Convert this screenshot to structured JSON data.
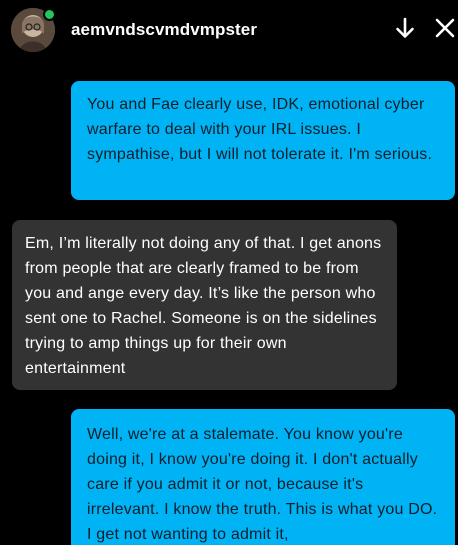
{
  "header": {
    "username": "aemvndscvmdvmpster",
    "avatar_icon": "user-avatar",
    "online_color": "#22c55e",
    "scroll_down_icon": "arrow-down-icon",
    "close_icon": "close-icon"
  },
  "colors": {
    "background": "#000000",
    "sent_bubble": "#00b3f5",
    "received_bubble": "#333333"
  },
  "messages": [
    {
      "direction": "sent",
      "text": "You and Fae clearly use, IDK, emotional cyber warfare to deal with your IRL issues. I sympathise, but I will not tolerate it. I'm serious."
    },
    {
      "direction": "received",
      "text": "Em, I’m literally not doing any of that. I get anons from people that are clearly framed to be from you and ange every day. It’s like the person who sent one to Rachel. Someone is on the sidelines trying to amp things up for their own entertainment"
    },
    {
      "direction": "sent",
      "text": "Well, we're at a stalemate. You know you're doing it, I know you're doing it. I don't actually care if you admit it or not, because it's irrelevant. I know the truth. This is what you DO. I get not wanting to admit it,"
    }
  ]
}
